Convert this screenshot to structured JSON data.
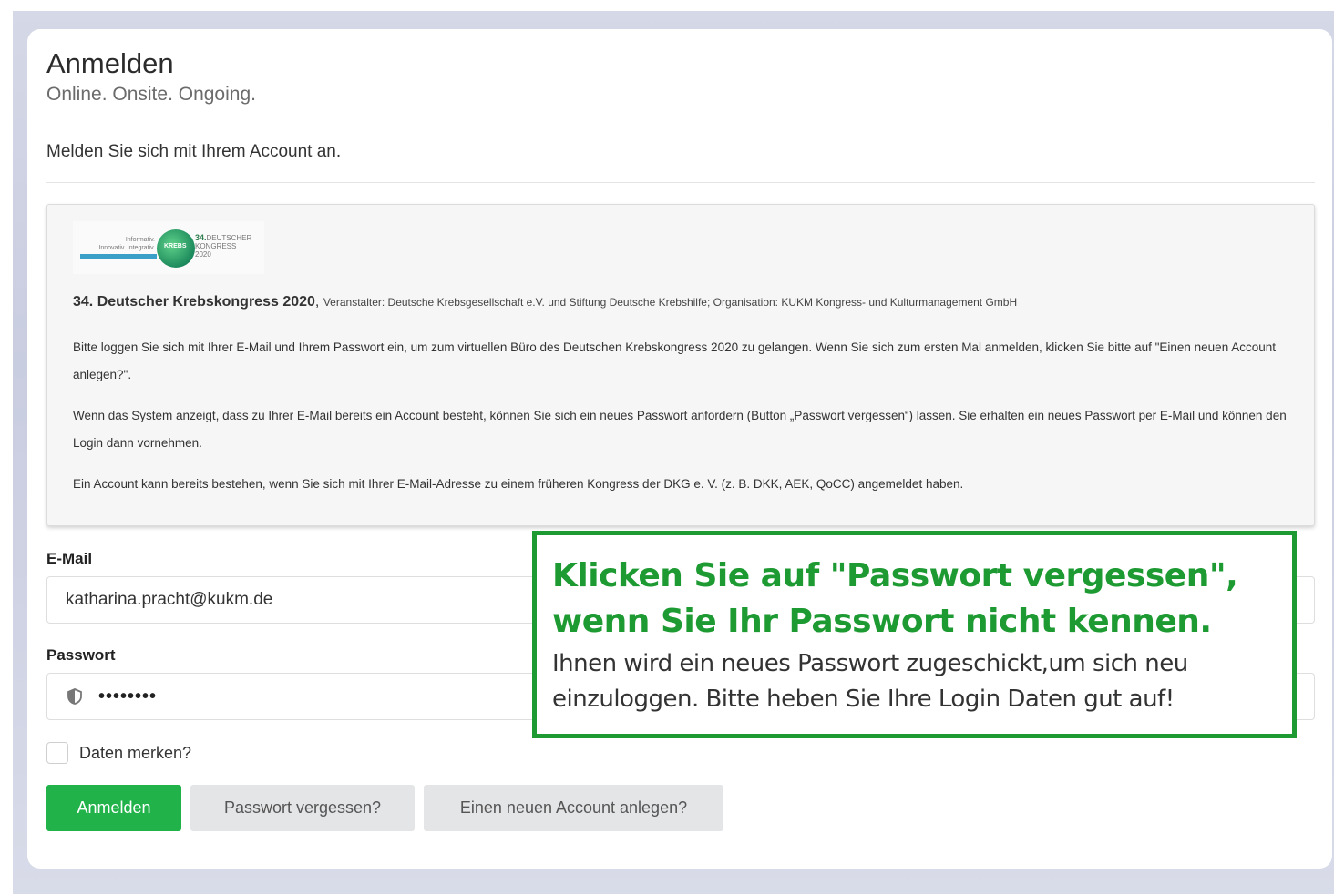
{
  "header": {
    "title": "Anmelden",
    "subtitle": "Online. Onsite. Ongoing.",
    "intro": "Melden Sie sich mit Ihrem Account an."
  },
  "infobox": {
    "logo": {
      "tagline_line1": "Informativ.",
      "tagline_line2": "Innovativ. Integrativ.",
      "circle_text": "KREBS",
      "right_number": "34.",
      "right_line1": "DEUTSCHER",
      "right_line2": "KONGRESS",
      "right_line3": "2020"
    },
    "event_name": "34. Deutscher Krebskongress 2020",
    "event_sep": ",",
    "event_org": "Veranstalter: Deutsche Krebsgesellschaft e.V. und Stiftung Deutsche Krebshilfe; Organisation: KUKM Kongress- und Kulturmanagement GmbH",
    "para1": "Bitte loggen Sie sich mit Ihrer E-Mail und Ihrem Passwort ein, um zum virtuellen Büro des Deutschen Krebskongress 2020 zu gelangen. Wenn Sie sich zum ersten Mal anmelden, klicken Sie bitte auf \"Einen neuen Account anlegen?\".",
    "para2": "Wenn das System anzeigt, dass zu Ihrer E-Mail bereits ein Account besteht, können Sie sich ein neues Passwort anfordern (Button „Passwort vergessen“) lassen. Sie erhalten ein neues Passwort per E-Mail und können den Login dann vornehmen.",
    "para3": "Ein Account kann bereits bestehen, wenn Sie sich mit Ihrer E-Mail-Adresse zu einem früheren Kongress der DKG e. V. (z. B. DKK, AEK, QoCC) angemeldet haben."
  },
  "form": {
    "email_label": "E-Mail",
    "email_value": "katharina.pracht@kukm.de",
    "password_label": "Passwort",
    "password_value": "••••••••",
    "remember_label": "Daten merken?",
    "remember_checked": false,
    "login_button": "Anmelden",
    "forgot_button": "Passwort vergessen?",
    "new_account_button": "Einen neuen Account anlegen?"
  },
  "callout": {
    "heading": "Klicken Sie auf \"Passwort vergessen\", wenn Sie Ihr Passwort nicht kennen.",
    "body": "Ihnen wird ein neues Passwort zugeschickt,um sich neu einzuloggen. Bitte heben Sie Ihre Login Daten gut auf!"
  },
  "colors": {
    "accent_green": "#21b24a",
    "callout_green": "#1e9a33"
  },
  "icons": {
    "password_field": "shield-icon"
  }
}
